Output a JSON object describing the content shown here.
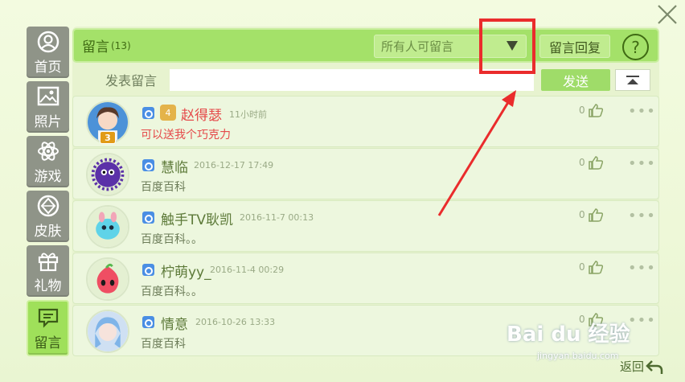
{
  "sidebar": {
    "items": [
      {
        "label": "首页",
        "icon": "user-icon"
      },
      {
        "label": "照片",
        "icon": "photo-icon"
      },
      {
        "label": "游戏",
        "icon": "atom-icon"
      },
      {
        "label": "皮肤",
        "icon": "diamond-icon"
      },
      {
        "label": "礼物",
        "icon": "gift-icon"
      },
      {
        "label": "留言",
        "icon": "message-icon"
      }
    ],
    "active_index": 5
  },
  "header": {
    "title": "留言",
    "count": "(13)",
    "filter_value": "所有人可留言",
    "reply_label": "留言回复",
    "help_label": "?"
  },
  "compose": {
    "label": "发表留言",
    "placeholder": "",
    "send_label": "发送"
  },
  "messages": [
    {
      "name": "赵得瑟",
      "time": "11小时前",
      "text": "可以送我个巧克力",
      "likes": "0",
      "level": "3",
      "vip_level": "4",
      "highlight": true
    },
    {
      "name": "慧临",
      "time": "2016-12-17  17:49",
      "text": "百度百科",
      "likes": "0"
    },
    {
      "name": "触手TV耿凯",
      "time": "2016-11-7  00:13",
      "text": "百度百科。。",
      "likes": "0"
    },
    {
      "name": "柠萌yy_",
      "time": "2016-11-4  00:29",
      "text": "百度百科。。",
      "likes": "0"
    },
    {
      "name": "情意",
      "time": "2016-10-26  13:33",
      "text": "百度百科",
      "likes": "0"
    }
  ],
  "more_label": "•••",
  "footer": {
    "back_label": "返回"
  },
  "watermark": {
    "text": "Bai du 经验",
    "url": "jingyan.baidu.com"
  },
  "colors": {
    "accent_green": "#a4e169",
    "annotation_red": "#ea2c2c",
    "sidebar_gray": "#8f9488"
  }
}
